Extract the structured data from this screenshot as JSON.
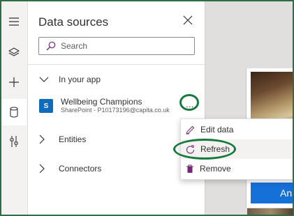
{
  "panel": {
    "title": "Data sources",
    "search_placeholder": "Search"
  },
  "groups": {
    "in_app": "In your app",
    "entities": "Entities",
    "connectors": "Connectors"
  },
  "source": {
    "name": "Wellbeing Champions",
    "sub": "SharePoint - P10173196@capita.co.uk",
    "icon_text": "S",
    "more": "..."
  },
  "menu": {
    "edit": "Edit data",
    "refresh": "Refresh",
    "remove": "Remove"
  },
  "canvas": {
    "button_label": "Ani"
  },
  "icons": [
    "hamburger-icon",
    "layers-icon",
    "plus-icon",
    "database-icon",
    "tools-icon",
    "close-icon",
    "search-icon",
    "chevron-down-icon",
    "chevron-right-icon",
    "sharepoint-icon",
    "pencil-icon",
    "refresh-icon",
    "trash-icon"
  ],
  "colors": {
    "annotation": "#157a3b",
    "accent": "#742774",
    "sharepoint": "#0f6cbd",
    "button": "#1570d8"
  }
}
